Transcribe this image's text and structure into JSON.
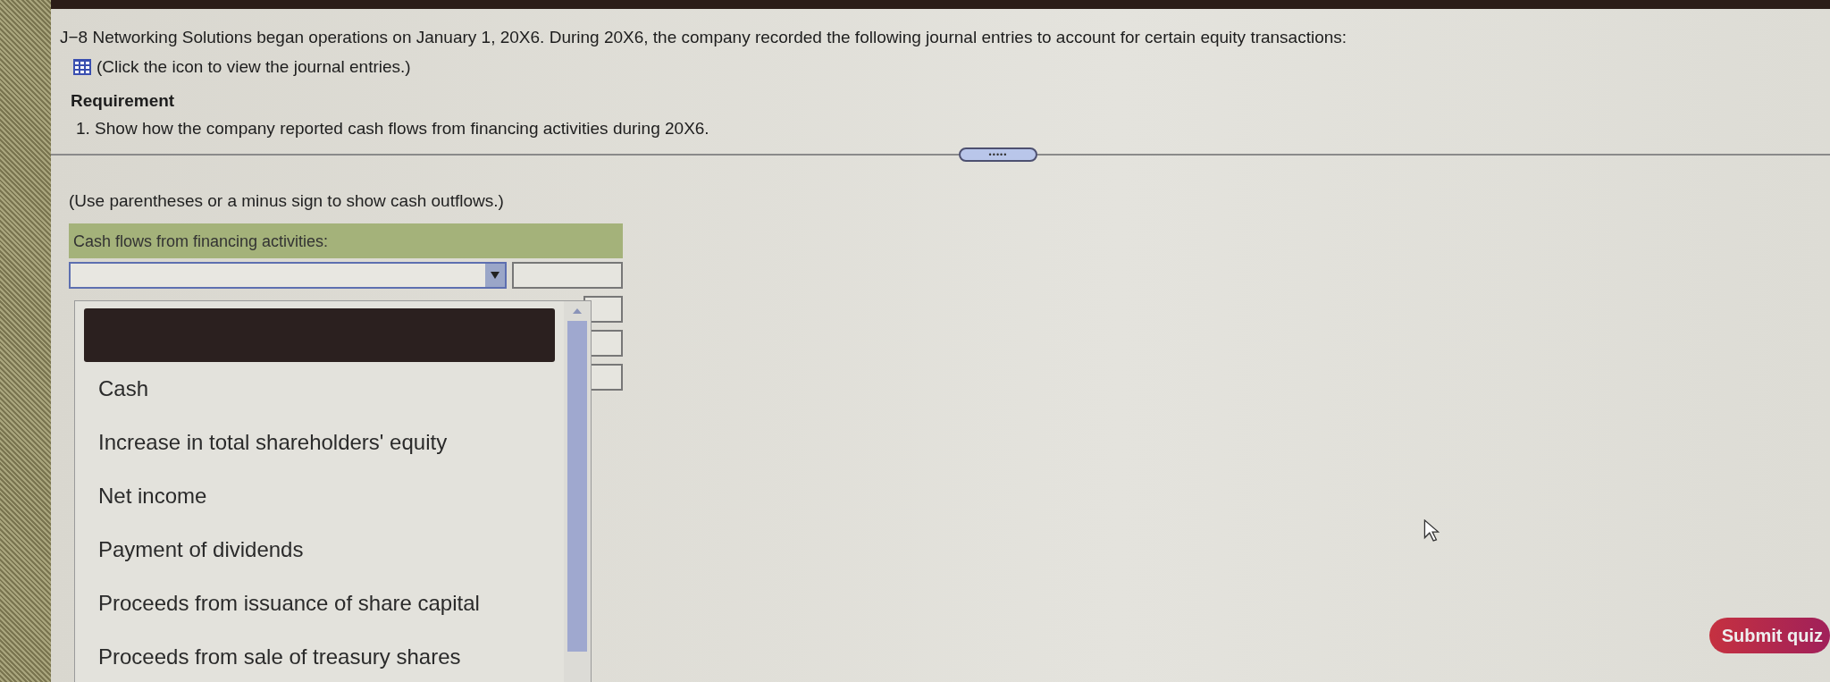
{
  "question": {
    "text": "J−8 Networking Solutions began operations on January 1, 20X6. During 20X6, the company recorded the following journal entries to account for certain equity transactions:",
    "link": "(Click the icon to view the journal entries.)"
  },
  "requirement": {
    "heading": "Requirement",
    "item": "1. Show how the company reported cash flows from financing activities during 20X6."
  },
  "divider_handle": "•••••",
  "hint": "(Use parentheses or a minus sign to show cash outflows.)",
  "table": {
    "header": "Cash flows from financing activities:"
  },
  "dropdown": {
    "blank_option": {
      "selected": true
    },
    "options": [
      {
        "label": "Cash",
        "selected": false
      },
      {
        "label": "Increase in total shareholders' equity",
        "selected": false
      },
      {
        "label": "Net income",
        "selected": false
      },
      {
        "label": "Payment of dividends",
        "selected": false
      },
      {
        "label": "Proceeds from issuance of share capital",
        "selected": false
      },
      {
        "label": "Proceeds from sale of treasury shares",
        "selected": false
      }
    ]
  },
  "submit_button": "Submit quiz"
}
